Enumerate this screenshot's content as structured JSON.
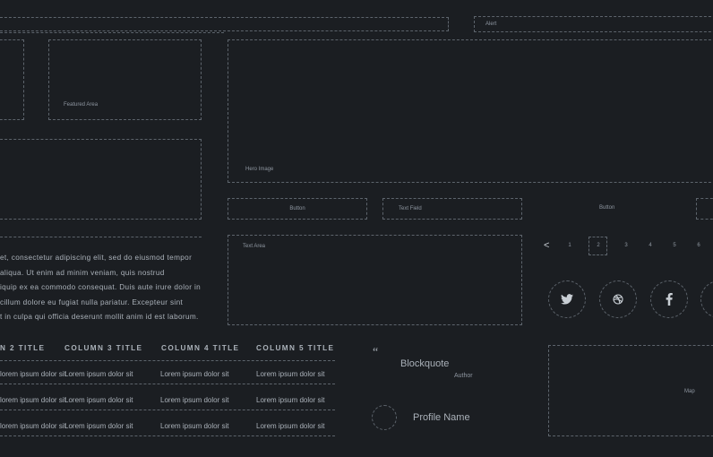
{
  "alert": {
    "label": "Alert"
  },
  "featured": {
    "label": "Featured Area"
  },
  "hero": {
    "label": "Hero Image"
  },
  "form": {
    "button1": "Button",
    "text_field": "Text Field",
    "button2": "Button",
    "text_area": "Text Area"
  },
  "paragraph": {
    "lines": [
      "et, consectetur adipiscing elit, sed do eiusmod tempor",
      "aliqua. Ut enim ad minim veniam, quis nostrud",
      "iquip ex ea commodo consequat. Duis aute irure dolor in",
      "cillum dolore eu fugiat nulla pariatur. Excepteur sint",
      "t in culpa qui officia deserunt mollit anim id est laborum."
    ]
  },
  "pagination": {
    "prev": "<",
    "pages": [
      "1",
      "2",
      "3",
      "4",
      "5",
      "6"
    ],
    "current": "2"
  },
  "social": [
    "twitter-icon",
    "dribbble-icon",
    "facebook-icon"
  ],
  "table": {
    "headers": [
      "N 2 TITLE",
      "COLUMN 3 TITLE",
      "COLUMN 4 TITLE",
      "COLUMN 5 TITLE"
    ],
    "rows": [
      [
        "lorem ipsum dolor sit",
        "Lorem ipsum dolor sit",
        "Lorem ipsum dolor sit",
        "Lorem ipsum dolor sit"
      ],
      [
        "lorem ipsum dolor sit",
        "Lorem ipsum dolor sit",
        "Lorem ipsum dolor sit",
        "Lorem ipsum dolor sit"
      ],
      [
        "lorem ipsum dolor sit",
        "Lorem ipsum dolor sit",
        "Lorem ipsum dolor sit",
        "Lorem ipsum dolor sit"
      ]
    ]
  },
  "blockquote": {
    "mark": "“",
    "text": "Blockquote",
    "author": "Author"
  },
  "profile": {
    "name": "Profile Name"
  },
  "map": {
    "label": "Map"
  },
  "colors": {
    "background": "#1b1e22",
    "dashed_border": "#5d646c",
    "text": "#aab1b9"
  }
}
